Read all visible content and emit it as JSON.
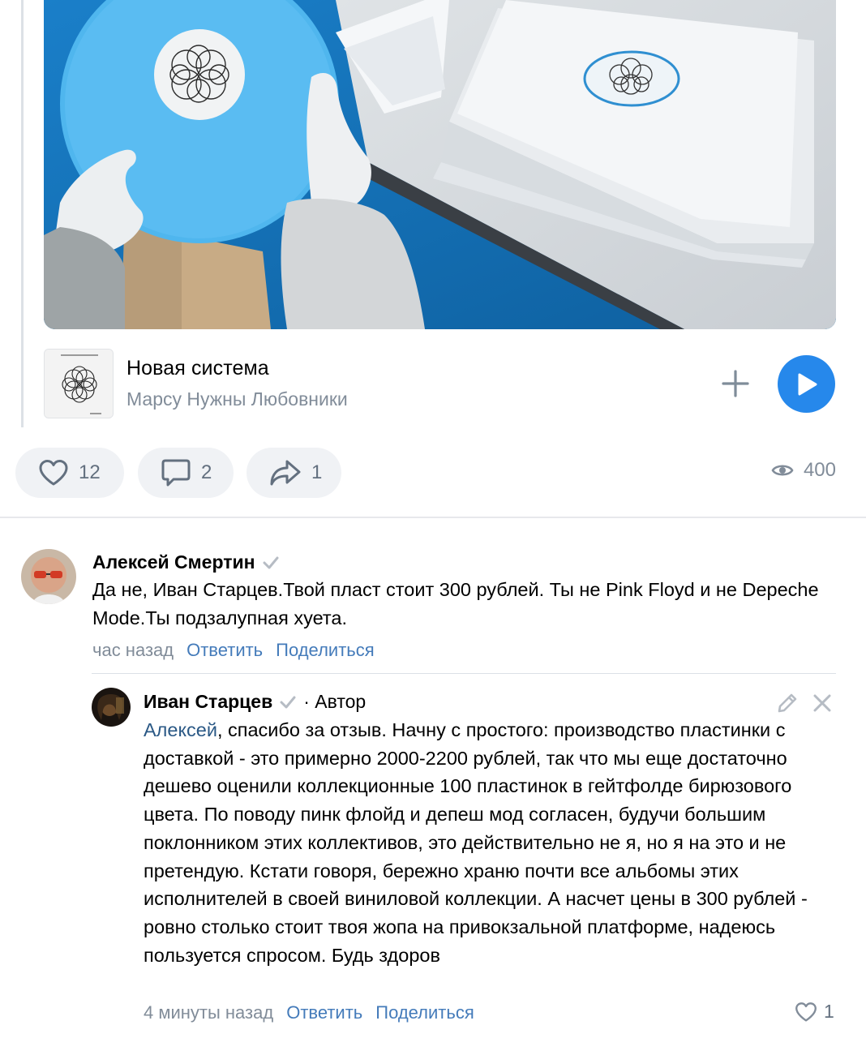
{
  "audio": {
    "title": "Новая система",
    "artist": "Марсу Нужны Любовники"
  },
  "actions": {
    "likes": "12",
    "comments": "2",
    "shares": "1",
    "views": "400"
  },
  "comments": [
    {
      "author": "Алексей Смертин",
      "text": "Да не, Иван Старцев.Твой пласт стоит 300 рублей. Ты не Pink Floyd и не Depeche Mode.Ты подзалупная хуета.",
      "time": "час назад",
      "reply_label": "Ответить",
      "share_label": "Поделиться"
    },
    {
      "author": "Иван Старцев",
      "role": "· Автор",
      "mention": "Алексей",
      "text": ", спасибо за отзыв. Начну с простого: производство пластинки с доставкой - это примерно 2000-2200 рублей, так что мы еще достаточно дешево оценили коллекционные 100 пластинок в гейтфолде бирюзового цвета. По поводу пинк флойд и депеш мод согласен, будучи большим поклонником этих коллективов, это действительно не я, но я на это и не претендую. Кстати говоря, бережно храню почти все альбомы этих исполнителей в своей виниловой коллекции. А насчет цены в 300 рублей - ровно столько стоит твоя жопа на привокзальной платформе, надеюсь пользуется спросом. Будь здоров",
      "time": "4 минуты назад",
      "reply_label": "Ответить",
      "share_label": "Поделиться",
      "likes": "1"
    }
  ],
  "colors": {
    "accent": "#2688eb",
    "link": "#447bba",
    "secondary_text": "#818c99",
    "pill_bg": "#f0f2f5"
  }
}
